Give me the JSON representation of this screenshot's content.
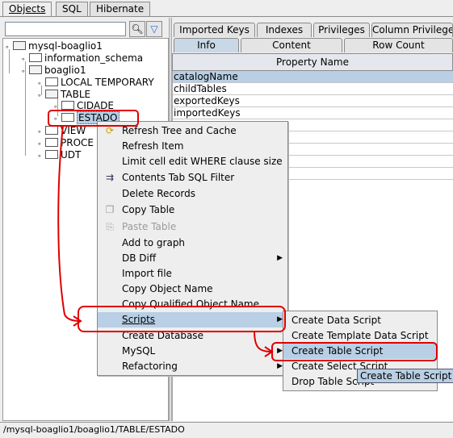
{
  "top_tabs": [
    "Objects",
    "SQL",
    "Hibernate"
  ],
  "tree": {
    "nodes": [
      "mysql-boaglio1",
      "information_schema",
      "boaglio1",
      "LOCAL TEMPORARY",
      "TABLE",
      "CIDADE",
      "ESTADO",
      "VIEW",
      "PROCE",
      "UDT"
    ]
  },
  "right": {
    "tabs_row1": [
      "Imported Keys",
      "Indexes",
      "Privileges",
      "Column Privileges"
    ],
    "tabs_row2": [
      "Info",
      "Content",
      "Row Count"
    ],
    "column_header": "Property Name",
    "rows": [
      "catalogName",
      "childTables",
      "exportedKeys",
      "importedKeys"
    ]
  },
  "context_menu": {
    "items": [
      "Refresh Tree and Cache",
      "Refresh Item",
      "Limit cell edit WHERE clause size",
      "Contents Tab SQL Filter",
      "Delete Records",
      "Copy Table",
      "Paste Table",
      "Add to graph",
      "DB Diff",
      "Import file",
      "Copy Object Name",
      "Copy Qualified Object Name",
      "Scripts",
      "Create Database",
      "MySQL",
      "Refactoring"
    ]
  },
  "submenu": {
    "items": [
      "Create Data Script",
      "Create Template Data Script",
      "Create Table Script",
      "Create Select Script",
      "Drop Table Script"
    ]
  },
  "tooltip": "Create Table Script",
  "status_bar": "/mysql-boaglio1/boaglio1/TABLE/ESTADO",
  "colors": {
    "selection": "#b8cfe5",
    "annotation": "#e00000"
  }
}
